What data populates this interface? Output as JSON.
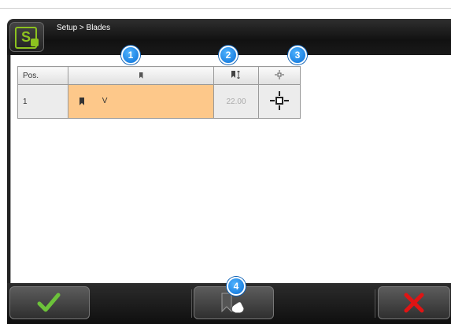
{
  "header": {
    "breadcrumb": "Setup > Blades"
  },
  "table": {
    "headers": {
      "pos": "Pos."
    },
    "rows": [
      {
        "pos": "1",
        "blade": "V",
        "value": "22.00"
      }
    ]
  },
  "callouts": [
    "1",
    "2",
    "3",
    "4"
  ],
  "colors": {
    "accent_green": "#8cc21f",
    "selected_row": "#fdc88a",
    "callout_blue": "#1a8ce8",
    "cancel_red": "#e01414"
  },
  "icons": {
    "app": "setup-app-icon",
    "blade_column": "bookmark-icon",
    "value_column": "bookmark-dimension-icon",
    "point_column": "crosshair-icon",
    "ok": "checkmark-icon",
    "mid": "bookmark-hand-icon",
    "cancel": "close-icon"
  }
}
